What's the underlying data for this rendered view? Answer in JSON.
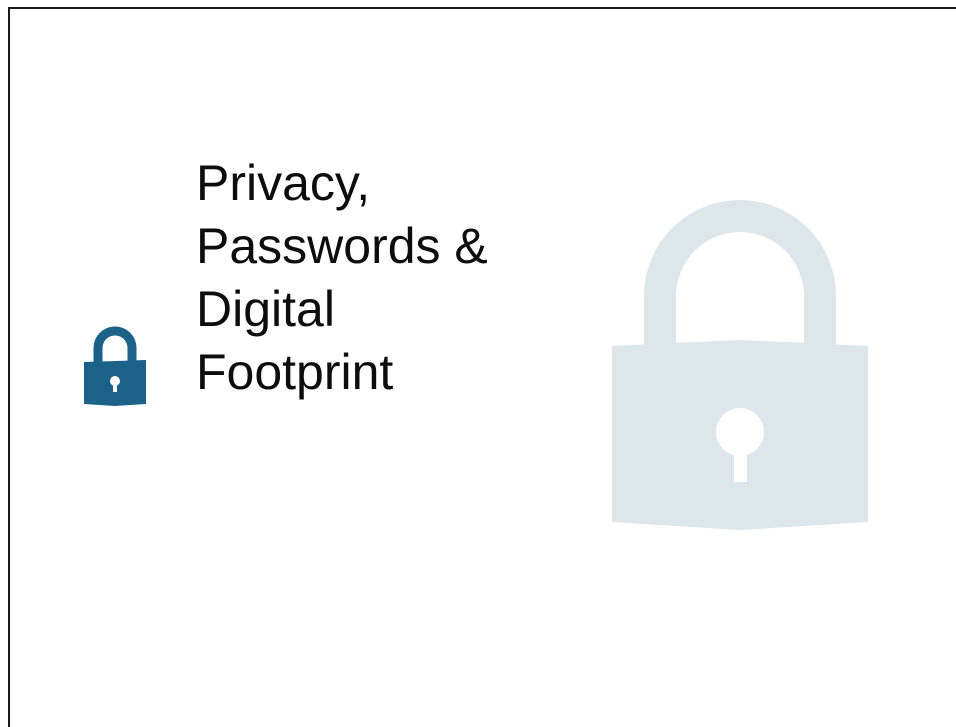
{
  "slide": {
    "title_lines": [
      "Privacy,",
      "Passwords &",
      "Digital",
      "Footprint"
    ]
  },
  "icons": {
    "small_lock": {
      "name": "padlock-icon",
      "color": "#1b6188"
    },
    "background_lock": {
      "name": "padlock-watermark-icon",
      "color": "#dde6eb"
    }
  }
}
